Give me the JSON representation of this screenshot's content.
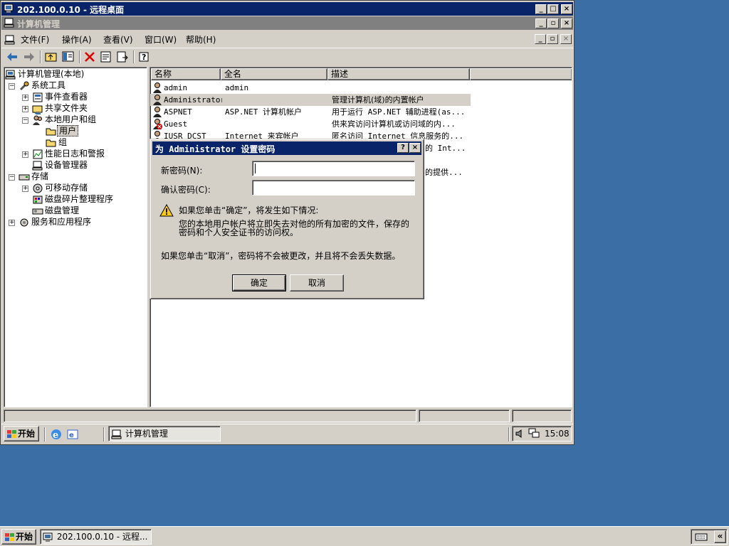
{
  "rdp": {
    "title": "202.100.0.10 - 远程桌面"
  },
  "mmc": {
    "title": "计算机管理"
  },
  "menu": [
    {
      "label": "文件(F)"
    },
    {
      "label": "操作(A)"
    },
    {
      "label": "查看(V)"
    },
    {
      "label": "窗口(W)"
    },
    {
      "label": "帮助(H)"
    }
  ],
  "tree": {
    "root": "计算机管理(本地)",
    "system_tools": "系统工具",
    "event_viewer": "事件查看器",
    "shared_folders": "共享文件夹",
    "local_users_groups": "本地用户和组",
    "users": "用户",
    "groups": "组",
    "perf_logs": "性能日志和警报",
    "device_manager": "设备管理器",
    "storage": "存储",
    "removable_storage": "可移动存储",
    "defrag": "磁盘碎片整理程序",
    "disk_mgmt": "磁盘管理",
    "services_apps": "服务和应用程序"
  },
  "list": {
    "headers": [
      "名称",
      "全名",
      "描述"
    ],
    "rows": [
      {
        "name": "admin",
        "fullname": "admin",
        "desc": ""
      },
      {
        "name": "Administrator",
        "fullname": "",
        "desc": "管理计算机(域)的内置帐户"
      },
      {
        "name": "ASPNET",
        "fullname": "ASP.NET 计算机帐户",
        "desc": "用于运行 ASP.NET 辅助进程(as..."
      },
      {
        "name": "Guest",
        "fullname": "",
        "desc": "供来宾访问计算机或访问域的内..."
      },
      {
        "name": "IUSR_DCST",
        "fullname": "Internet 来宾帐户",
        "desc": "匿名访问 Internet 信息服务的..."
      }
    ],
    "partial_desc_1": "的 Int...",
    "partial_desc_2": "的提供..."
  },
  "dialog": {
    "title": "为 Administrator 设置密码",
    "help_btn": "?",
    "close_btn": "×",
    "new_pw_label": "新密码(N):",
    "confirm_pw_label": "确认密码(C):",
    "warn_line1": "如果您单击“确定”，将发生如下情况:",
    "warn_line2": "您的本地用户帐户将立即失去对他的所有加密的文件，保存的",
    "warn_line3": "密码和个人安全证书的访问权。",
    "cancel_note": "如果您单击“取消”，密码将不会被更改，并且将不会丢失数据。",
    "ok": "确定",
    "cancel": "取消"
  },
  "inner_taskbar": {
    "start": "开始",
    "task": "计算机管理",
    "clock": "15:08"
  },
  "outer_taskbar": {
    "start": "开始",
    "task": "202.100.0.10 - 远程...",
    "chevron": "«"
  },
  "colors": {
    "desktop": "#3a6ea5",
    "titlebar_active": "#0a246a",
    "titlebar_inactive": "#808080",
    "face": "#d4d0c8"
  }
}
